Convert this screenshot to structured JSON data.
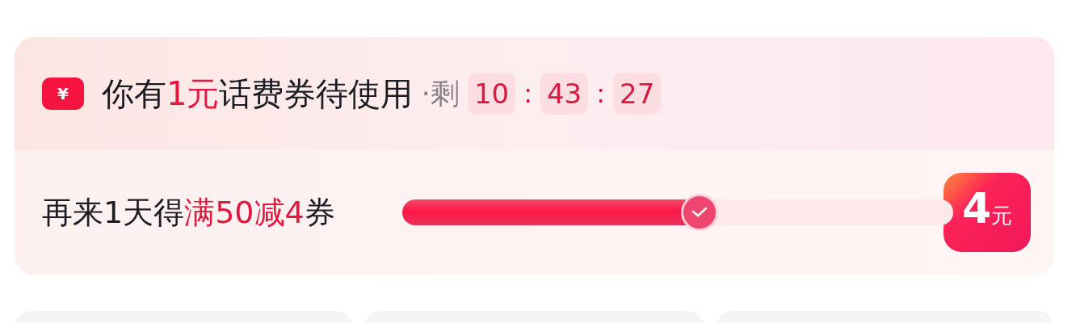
{
  "coupon_notice": {
    "icon_text": "¥",
    "title_parts": [
      {
        "text": "你有",
        "highlight": false
      },
      {
        "text": "1元",
        "highlight": true
      },
      {
        "text": "话费券待使用",
        "highlight": false
      }
    ],
    "remaining_label": "·剩",
    "timer": [
      "10",
      "43",
      "27"
    ],
    "separators": [
      ":",
      ":"
    ]
  },
  "progress": {
    "label_parts": [
      {
        "text": "再来1天得",
        "highlight": false
      },
      {
        "text": "满50减4",
        "highlight": true
      },
      {
        "text": "券",
        "highlight": false
      }
    ],
    "level": 0.54,
    "reached": true,
    "reward": {
      "amount": "4",
      "unit": "元"
    }
  }
}
